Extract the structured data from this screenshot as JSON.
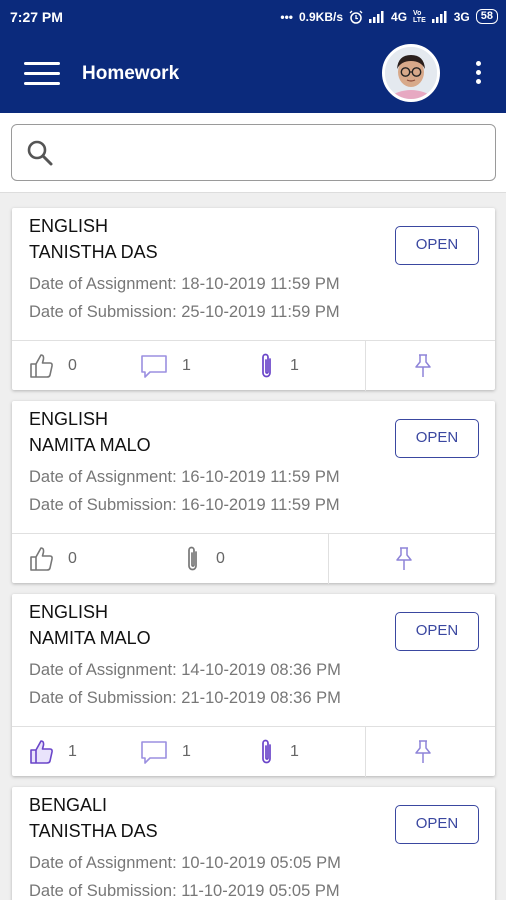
{
  "status_bar": {
    "time": "7:27 PM",
    "speed": "0.9KB/s",
    "net1": "4G",
    "net2": "3G",
    "battery": "58"
  },
  "app_bar": {
    "title": "Homework"
  },
  "search": {
    "placeholder": ""
  },
  "colors": {
    "primary": "#0b2a7c",
    "accent": "#3a47a0",
    "icon_purple": "#6a45c9"
  },
  "cards": [
    {
      "subject": "ENGLISH",
      "teacher": "TANISTHA DAS",
      "assignment": "Date of Assignment: 18-10-2019 11:59 PM",
      "submission": "Date of Submission: 25-10-2019 11:59 PM",
      "button": "OPEN",
      "likes": "0",
      "comments": "1",
      "attachments": "1"
    },
    {
      "subject": "ENGLISH",
      "teacher": "NAMITA MALO",
      "assignment": "Date of Assignment: 16-10-2019 11:59 PM",
      "submission": "Date of Submission: 16-10-2019 11:59 PM",
      "button": "OPEN",
      "likes": "0",
      "attachments": "0"
    },
    {
      "subject": "ENGLISH",
      "teacher": "NAMITA MALO",
      "assignment": "Date of Assignment: 14-10-2019 08:36 PM",
      "submission": "Date of Submission: 21-10-2019 08:36 PM",
      "button": "OPEN",
      "likes": "1",
      "comments": "1",
      "attachments": "1"
    },
    {
      "subject": "BENGALI",
      "teacher": "TANISTHA DAS",
      "assignment": "Date of Assignment: 10-10-2019 05:05 PM",
      "submission": "Date of Submission: 11-10-2019 05:05 PM",
      "button": "OPEN"
    }
  ]
}
